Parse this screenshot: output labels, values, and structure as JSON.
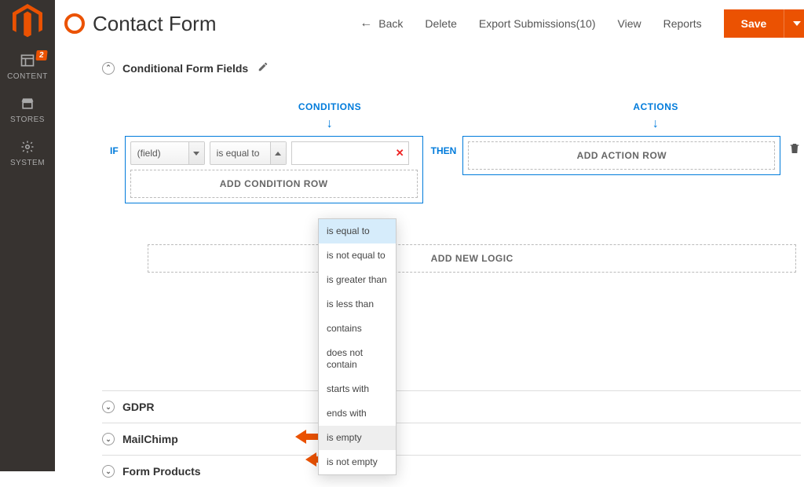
{
  "sidebar": {
    "items": [
      {
        "label": "CONTENT",
        "badge": "2"
      },
      {
        "label": "STORES"
      },
      {
        "label": "SYSTEM"
      }
    ]
  },
  "header": {
    "title": "Contact Form",
    "actions": {
      "back": "Back",
      "delete": "Delete",
      "export": "Export Submissions(10)",
      "view": "View",
      "reports": "Reports",
      "save": "Save"
    }
  },
  "section": {
    "conditional_fields": "Conditional Form Fields",
    "gdpr": "GDPR",
    "mailchimp": "MailChimp",
    "form_products": "Form Products"
  },
  "conditions": {
    "conditions_label": "CONDITIONS",
    "actions_label": "ACTIONS",
    "if_label": "IF",
    "then_label": "THEN",
    "field_placeholder": "(field)",
    "operator_selected": "is equal to",
    "value": "",
    "add_condition_row": "ADD CONDITION ROW",
    "add_action_row": "ADD ACTION ROW",
    "add_new_logic": "ADD NEW LOGIC",
    "operator_options": [
      "is equal to",
      "is not equal to",
      "is greater than",
      "is less than",
      "contains",
      "does not contain",
      "starts with",
      "ends with",
      "is empty",
      "is not empty"
    ]
  }
}
